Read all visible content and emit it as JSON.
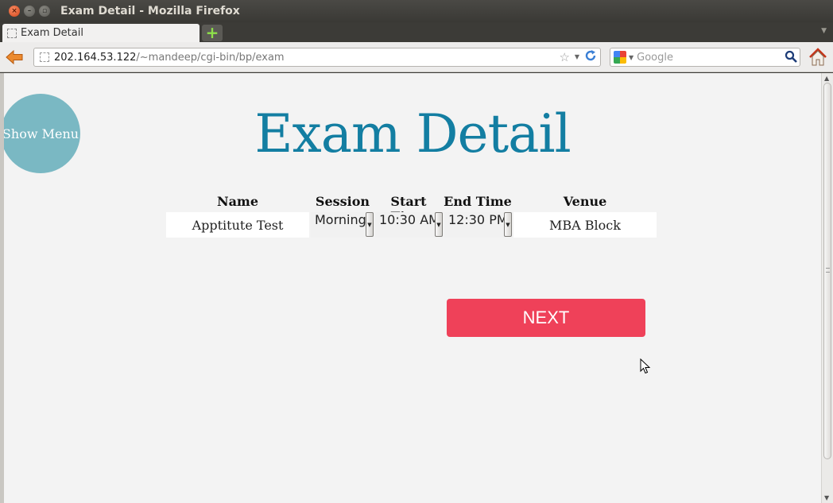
{
  "window": {
    "title": "Exam Detail - Mozilla Firefox",
    "controls": {
      "close": "×",
      "minimize": "–",
      "maximize": "▫"
    }
  },
  "tabs": [
    {
      "label": "Exam Detail"
    }
  ],
  "new_tab_symbol": "+",
  "address_bar": {
    "host": "202.164.53.122",
    "path": "/~mandeep/cgi-bin/bp/exam"
  },
  "search": {
    "placeholder": "Google"
  },
  "colors": {
    "title": "#137ea2",
    "menu_circle": "#7ab8c3",
    "next_button": "#ef4159",
    "page_background": "#f3f3f3"
  },
  "icons": [
    "back-arrow-icon",
    "page-icon",
    "bookmark-star-icon",
    "reload-icon",
    "google-icon",
    "search-icon",
    "home-icon",
    "new-tab-icon"
  ],
  "page": {
    "menu_button": "Show Menu",
    "title": "Exam Detail",
    "columns": {
      "name": "Name",
      "session": "Session",
      "start_time": "Start Time",
      "end_time": "End Time",
      "venue": "Venue"
    },
    "row": {
      "name": "Apptitute Test",
      "session": "Morning",
      "start_time": "10:30 AM",
      "end_time": "12:30 PM",
      "venue": "MBA Block"
    },
    "next_button": "NEXT"
  }
}
